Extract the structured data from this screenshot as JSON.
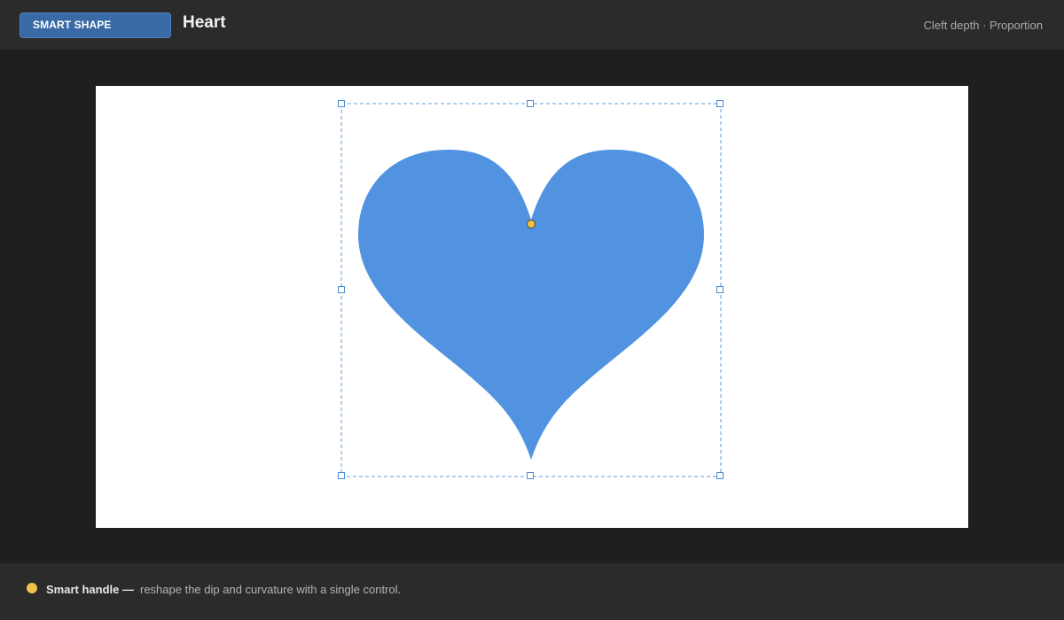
{
  "header": {
    "badge_label": "SMART SHAPE",
    "shape_title": "Heart",
    "hint": "Cleft depth · Proportion"
  },
  "shape": {
    "name": "heart",
    "fill_color": "#5193e0",
    "selection_color": "#5f9fdc",
    "smart_handle_color": "#f2c04c"
  },
  "footer": {
    "legend_label": "Smart handle —",
    "legend_text": "reshape the dip and curvature with a single control."
  }
}
